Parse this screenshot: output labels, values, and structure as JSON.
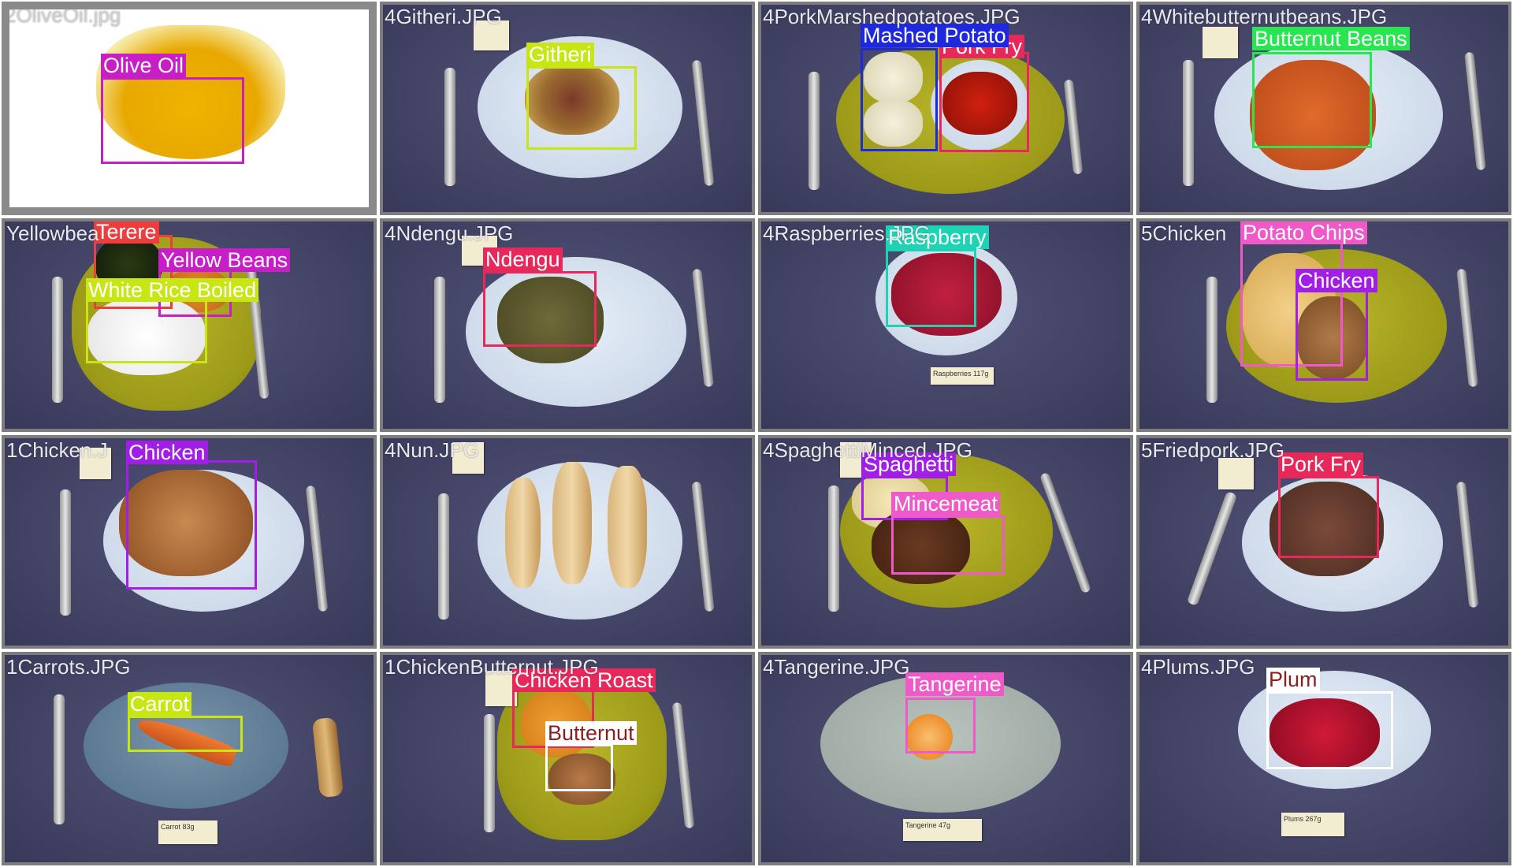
{
  "tiles": [
    {
      "filename": "2OliveOil.jpg",
      "labels": [
        "Olive Oil"
      ]
    },
    {
      "filename": "4Githeri.JPG",
      "labels": [
        "Githeri"
      ]
    },
    {
      "filename": "4PorkMarshedpotatoes.JPG",
      "labels": [
        "Mashed Potato",
        "Pork Fry"
      ]
    },
    {
      "filename": "4Whitebutternutbeans.JPG",
      "labels": [
        "Butternut Beans"
      ]
    },
    {
      "filename": "YellowbeanRiceTerere.JPG",
      "labels": [
        "Terere",
        "Yellow Beans",
        "White Rice Boiled"
      ]
    },
    {
      "filename": "4Ndengu.JPG",
      "labels": [
        "Ndengu"
      ]
    },
    {
      "filename": "4Raspberries.JPG",
      "labels": [
        "Raspberry"
      ]
    },
    {
      "filename": "5ChickenChips.JPG",
      "labels": [
        "Potato Chips",
        "Chicken"
      ]
    },
    {
      "filename": "1Chicken.JPG",
      "labels": [
        "Chicken"
      ]
    },
    {
      "filename": "4Nun.JPG",
      "labels": []
    },
    {
      "filename": "4SpaghettiMinced.JPG",
      "labels": [
        "Spaghetti",
        "Mincemeat"
      ]
    },
    {
      "filename": "5Friedpork.JPG",
      "labels": [
        "Pork Fry"
      ]
    },
    {
      "filename": "1Carrots.JPG",
      "labels": [
        "Carrot"
      ]
    },
    {
      "filename": "1ChickenButternut.JPG",
      "labels": [
        "Chicken Roast",
        "Butternut"
      ]
    },
    {
      "filename": "4Tangerine.JPG",
      "labels": [
        "Tangerine"
      ]
    },
    {
      "filename": "4Plums.JPG",
      "labels": [
        "Plum"
      ]
    }
  ],
  "notes": {
    "raspberries": "Raspberries 117g",
    "carrot": "Carrot 83g",
    "tangerine": "Tangerine 47g",
    "plums": "Plums 267g"
  },
  "colors": {
    "magenta": "#c81ec8",
    "yellow_green": "#c8e614",
    "blue": "#1e28dc",
    "crimson": "#e6285a",
    "green": "#28e650",
    "red": "#f03c3c",
    "purple": "#a01ee6",
    "pink": "#f05ac8",
    "teal": "#1ed2b4",
    "white": "#ffffff",
    "dark_red": "#8c1e1e"
  }
}
